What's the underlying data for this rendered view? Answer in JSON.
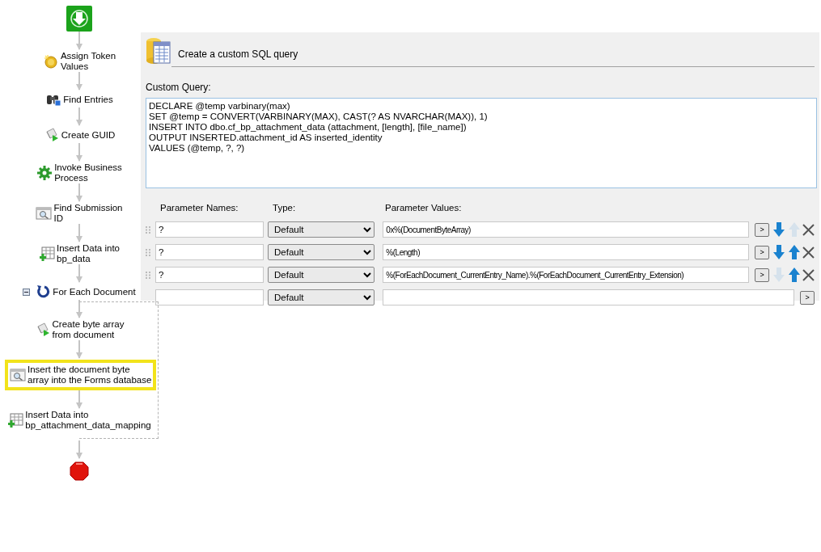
{
  "workflow": [
    {
      "kind": "assign_tokens",
      "lines": [
        "Assign Token",
        "Values"
      ],
      "selected": false
    },
    {
      "kind": "find_entries",
      "lines": [
        "Find Entries"
      ],
      "selected": false
    },
    {
      "kind": "script",
      "lines": [
        "Create GUID"
      ],
      "selected": false
    },
    {
      "kind": "invoke_process",
      "lines": [
        "Invoke Business",
        "Process"
      ],
      "selected": false
    },
    {
      "kind": "query",
      "lines": [
        "Find Submission",
        "ID"
      ],
      "selected": false
    },
    {
      "kind": "insert_data",
      "lines": [
        "Insert Data into",
        "bp_data"
      ],
      "selected": false
    },
    {
      "kind": "for_each",
      "lines": [
        "For Each Document"
      ],
      "selected": false,
      "expanded": true,
      "children": [
        {
          "kind": "script",
          "lines": [
            "Create byte array",
            "from document"
          ],
          "selected": false
        },
        {
          "kind": "query",
          "lines": [
            "Insert the document byte",
            "array into the Forms database"
          ],
          "selected": true
        },
        {
          "kind": "insert_data",
          "lines": [
            "Insert Data into",
            "bp_attachment_data_mapping"
          ],
          "selected": false
        }
      ]
    }
  ],
  "panel": {
    "title": "Create a custom SQL query",
    "query_label": "Custom Query:",
    "query": "DECLARE @temp varbinary(max)\nSET @temp = CONVERT(VARBINARY(MAX), CAST(? AS NVARCHAR(MAX)), 1)\nINSERT INTO dbo.cf_bp_attachment_data (attachment, [length], [file_name])\nOUTPUT INSERTED.attachment_id AS inserted_identity\nVALUES (@temp, ?, ?)",
    "columns": [
      "Parameter Names:",
      "Type:",
      "Parameter Values:"
    ],
    "parameters": [
      {
        "kind": "entry",
        "name": "?",
        "type": "Default",
        "value": "0x%(DocumentByteArray)",
        "button": ">",
        "move_down_enabled": true,
        "move_up_enabled": false
      },
      {
        "kind": "entry",
        "name": "?",
        "type": "Default",
        "value": "%(Length)",
        "button": ">",
        "move_down_enabled": true,
        "move_up_enabled": true
      },
      {
        "kind": "entry",
        "name": "?",
        "type": "Default",
        "value": "%(ForEachDocument_CurrentEntry_Name).%(ForEachDocument_CurrentEntry_Extension)",
        "button": ">",
        "move_down_enabled": false,
        "move_up_enabled": true
      },
      {
        "kind": "new",
        "type": "Default",
        "button": ">"
      }
    ]
  }
}
